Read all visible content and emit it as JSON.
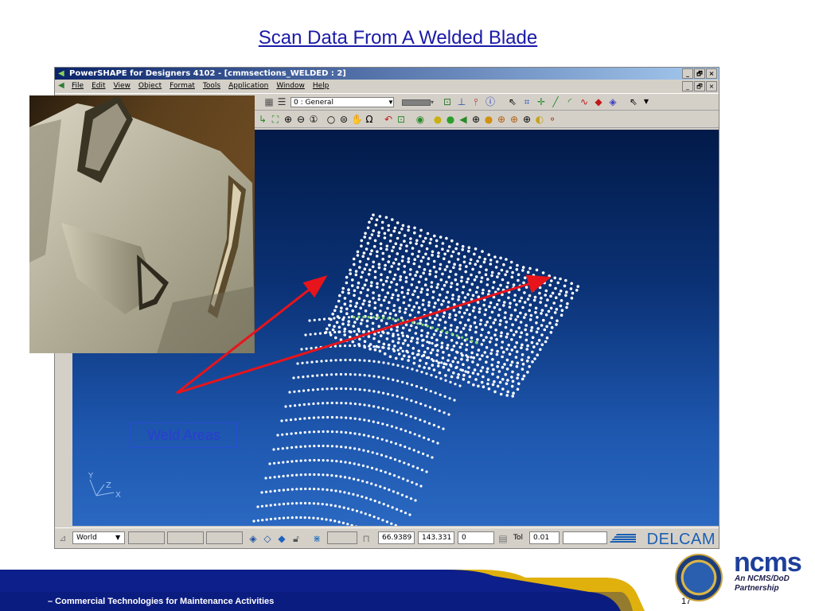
{
  "slide": {
    "title": "Scan Data From A Welded Blade",
    "weld_label": "Weld Areas",
    "footer_text": "– Commercial Technologies for Maintenance Activities",
    "page_number": "17"
  },
  "app": {
    "window_title": "PowerSHAPE for Designers 4102 - [cmmsections_WELDED : 2]",
    "title_buttons": [
      "_",
      "🗗",
      "×"
    ],
    "menu": [
      "File",
      "Edit",
      "View",
      "Object",
      "Format",
      "Tools",
      "Application",
      "Window",
      "Help"
    ],
    "toolbar": {
      "layer_value": "0  : General"
    },
    "axis_labels": {
      "y": "Y",
      "z": "Z",
      "x": "X"
    },
    "status": {
      "workplane": "World",
      "coord_x": "66.9389",
      "coord_y": "143.331",
      "coord_z": "0",
      "tol_label": "Tol",
      "tol_value": "0.01",
      "brand": "DELCAM"
    }
  },
  "logos": {
    "ncms": "ncms",
    "ncms_sub1": "An NCMS/DoD",
    "ncms_sub2": "Partnership"
  },
  "colors": {
    "title_blue": "#1a1aa8",
    "arrow_red": "#e8141b",
    "viewport_top": "#021a49",
    "viewport_bottom": "#2a68c1",
    "footer_blue": "#0d1f8a",
    "footer_gold": "#e0b10c",
    "delcam_blue": "#1a5fb4"
  }
}
